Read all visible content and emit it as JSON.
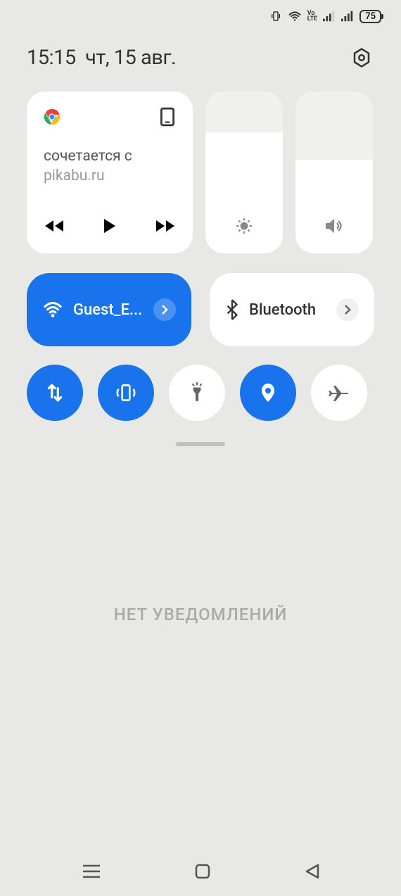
{
  "status_bar": {
    "battery_level": "75"
  },
  "header": {
    "time": "15:15",
    "date": "чт, 15 авг."
  },
  "media": {
    "title": "сочетается с",
    "subtitle": "pikabu.ru"
  },
  "sliders": {
    "brightness_pct": 75,
    "volume_pct": 58
  },
  "toggles": {
    "wifi": {
      "label": "Guest_E...",
      "active": true
    },
    "bluetooth": {
      "label": "Bluetooth",
      "active": false
    }
  },
  "quick_toggles": {
    "data": {
      "active": true
    },
    "vibrate": {
      "active": true
    },
    "flashlight": {
      "active": false
    },
    "location": {
      "active": true
    },
    "airplane": {
      "active": false
    }
  },
  "notifications": {
    "empty_label": "НЕТ УВЕДОМЛЕНИЙ"
  }
}
